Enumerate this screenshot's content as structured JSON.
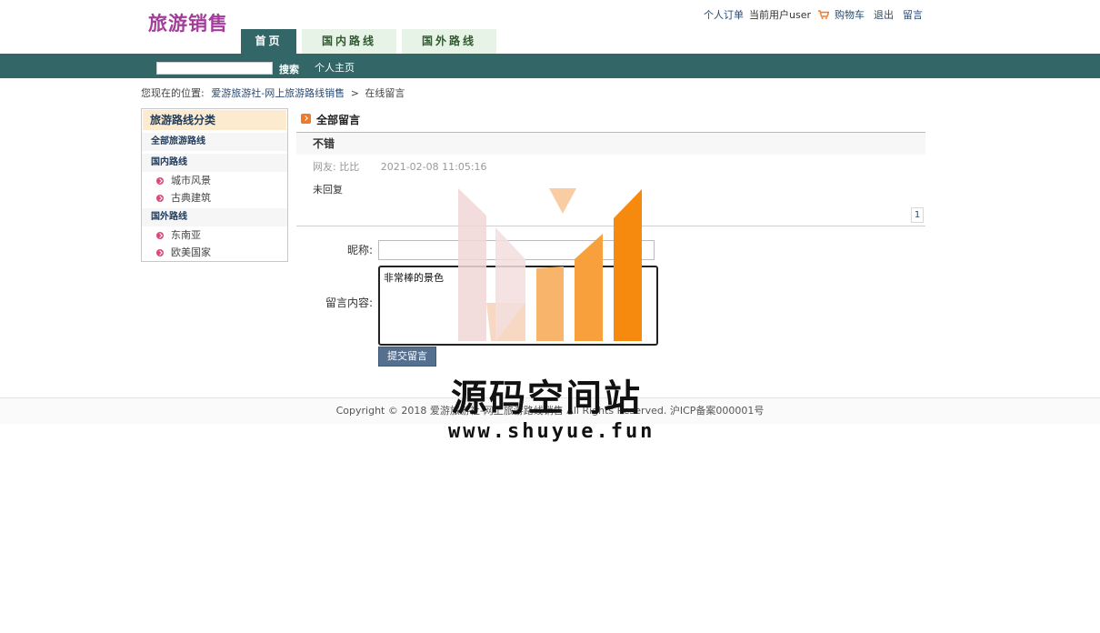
{
  "header": {
    "brand": "旅游销售",
    "links": {
      "orders": "个人订单",
      "current_user": "当前用户user",
      "cart": "购物车",
      "logout": "退出",
      "message": "留言"
    }
  },
  "nav": {
    "tabs": [
      "首页",
      "国内路线",
      "国外路线"
    ],
    "active_index": 0
  },
  "searchbar": {
    "search_label": "搜索",
    "home_label": "个人主页",
    "search_value": ""
  },
  "breadcrumb": {
    "prefix": "您现在的位置:",
    "site": "爱游旅游社-网上旅游路线销售",
    "separator": ">",
    "current": "在线留言"
  },
  "sidebar": {
    "title": "旅游路线分类",
    "all_routes": "全部旅游路线",
    "groups": [
      {
        "name": "国内路线",
        "items": [
          "城市风景",
          "古典建筑"
        ]
      },
      {
        "name": "国外路线",
        "items": [
          "东南亚",
          "欧美国家"
        ]
      }
    ]
  },
  "main": {
    "title": "全部留言",
    "message": {
      "subject": "不错",
      "author_label": "网友:",
      "author": "比比",
      "datetime": "2021-02-08 11:05:16",
      "reply_status": "未回复"
    },
    "pager": {
      "page": "1"
    },
    "form": {
      "nickname_label": "昵称:",
      "nickname_value": "",
      "content_label": "留言内容:",
      "content_value": "非常棒的景色",
      "submit_label": "提交留言"
    }
  },
  "footer": {
    "text": "Copyright © 2018 爱游旅游社-网上旅游路线销售 All Rights Reserved. 沪ICP备案000001号"
  },
  "watermark": {
    "title": "源码空间站",
    "url": "www.shuyue.fun"
  },
  "colors": {
    "brand": "#a33d9a",
    "nav_dark": "#336666",
    "nav_light": "#e8f3e8",
    "accent_orange": "#f5891f",
    "submit_button": "#55708f"
  }
}
